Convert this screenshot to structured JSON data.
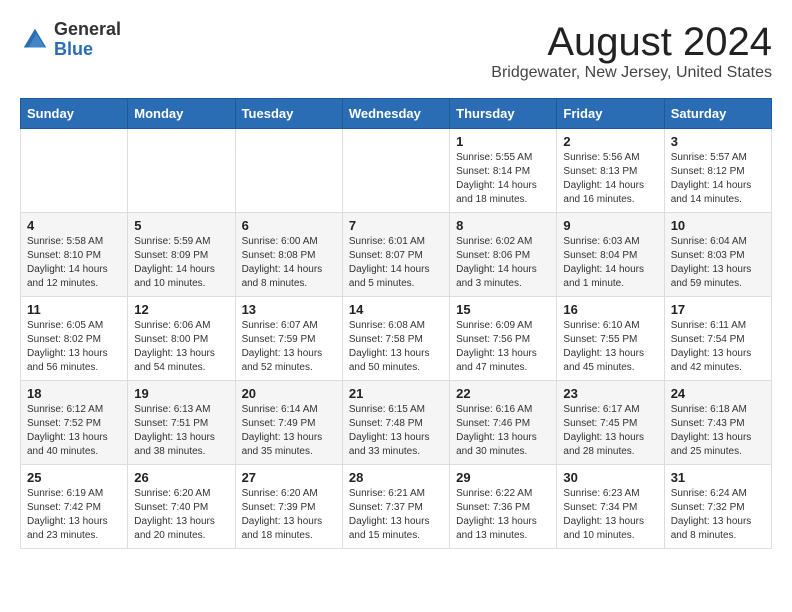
{
  "header": {
    "logo_general": "General",
    "logo_blue": "Blue",
    "main_title": "August 2024",
    "subtitle": "Bridgewater, New Jersey, United States"
  },
  "days_of_week": [
    "Sunday",
    "Monday",
    "Tuesday",
    "Wednesday",
    "Thursday",
    "Friday",
    "Saturday"
  ],
  "weeks": [
    [
      {
        "day": "",
        "info": ""
      },
      {
        "day": "",
        "info": ""
      },
      {
        "day": "",
        "info": ""
      },
      {
        "day": "",
        "info": ""
      },
      {
        "day": "1",
        "info": "Sunrise: 5:55 AM\nSunset: 8:14 PM\nDaylight: 14 hours\nand 18 minutes."
      },
      {
        "day": "2",
        "info": "Sunrise: 5:56 AM\nSunset: 8:13 PM\nDaylight: 14 hours\nand 16 minutes."
      },
      {
        "day": "3",
        "info": "Sunrise: 5:57 AM\nSunset: 8:12 PM\nDaylight: 14 hours\nand 14 minutes."
      }
    ],
    [
      {
        "day": "4",
        "info": "Sunrise: 5:58 AM\nSunset: 8:10 PM\nDaylight: 14 hours\nand 12 minutes."
      },
      {
        "day": "5",
        "info": "Sunrise: 5:59 AM\nSunset: 8:09 PM\nDaylight: 14 hours\nand 10 minutes."
      },
      {
        "day": "6",
        "info": "Sunrise: 6:00 AM\nSunset: 8:08 PM\nDaylight: 14 hours\nand 8 minutes."
      },
      {
        "day": "7",
        "info": "Sunrise: 6:01 AM\nSunset: 8:07 PM\nDaylight: 14 hours\nand 5 minutes."
      },
      {
        "day": "8",
        "info": "Sunrise: 6:02 AM\nSunset: 8:06 PM\nDaylight: 14 hours\nand 3 minutes."
      },
      {
        "day": "9",
        "info": "Sunrise: 6:03 AM\nSunset: 8:04 PM\nDaylight: 14 hours\nand 1 minute."
      },
      {
        "day": "10",
        "info": "Sunrise: 6:04 AM\nSunset: 8:03 PM\nDaylight: 13 hours\nand 59 minutes."
      }
    ],
    [
      {
        "day": "11",
        "info": "Sunrise: 6:05 AM\nSunset: 8:02 PM\nDaylight: 13 hours\nand 56 minutes."
      },
      {
        "day": "12",
        "info": "Sunrise: 6:06 AM\nSunset: 8:00 PM\nDaylight: 13 hours\nand 54 minutes."
      },
      {
        "day": "13",
        "info": "Sunrise: 6:07 AM\nSunset: 7:59 PM\nDaylight: 13 hours\nand 52 minutes."
      },
      {
        "day": "14",
        "info": "Sunrise: 6:08 AM\nSunset: 7:58 PM\nDaylight: 13 hours\nand 50 minutes."
      },
      {
        "day": "15",
        "info": "Sunrise: 6:09 AM\nSunset: 7:56 PM\nDaylight: 13 hours\nand 47 minutes."
      },
      {
        "day": "16",
        "info": "Sunrise: 6:10 AM\nSunset: 7:55 PM\nDaylight: 13 hours\nand 45 minutes."
      },
      {
        "day": "17",
        "info": "Sunrise: 6:11 AM\nSunset: 7:54 PM\nDaylight: 13 hours\nand 42 minutes."
      }
    ],
    [
      {
        "day": "18",
        "info": "Sunrise: 6:12 AM\nSunset: 7:52 PM\nDaylight: 13 hours\nand 40 minutes."
      },
      {
        "day": "19",
        "info": "Sunrise: 6:13 AM\nSunset: 7:51 PM\nDaylight: 13 hours\nand 38 minutes."
      },
      {
        "day": "20",
        "info": "Sunrise: 6:14 AM\nSunset: 7:49 PM\nDaylight: 13 hours\nand 35 minutes."
      },
      {
        "day": "21",
        "info": "Sunrise: 6:15 AM\nSunset: 7:48 PM\nDaylight: 13 hours\nand 33 minutes."
      },
      {
        "day": "22",
        "info": "Sunrise: 6:16 AM\nSunset: 7:46 PM\nDaylight: 13 hours\nand 30 minutes."
      },
      {
        "day": "23",
        "info": "Sunrise: 6:17 AM\nSunset: 7:45 PM\nDaylight: 13 hours\nand 28 minutes."
      },
      {
        "day": "24",
        "info": "Sunrise: 6:18 AM\nSunset: 7:43 PM\nDaylight: 13 hours\nand 25 minutes."
      }
    ],
    [
      {
        "day": "25",
        "info": "Sunrise: 6:19 AM\nSunset: 7:42 PM\nDaylight: 13 hours\nand 23 minutes."
      },
      {
        "day": "26",
        "info": "Sunrise: 6:20 AM\nSunset: 7:40 PM\nDaylight: 13 hours\nand 20 minutes."
      },
      {
        "day": "27",
        "info": "Sunrise: 6:20 AM\nSunset: 7:39 PM\nDaylight: 13 hours\nand 18 minutes."
      },
      {
        "day": "28",
        "info": "Sunrise: 6:21 AM\nSunset: 7:37 PM\nDaylight: 13 hours\nand 15 minutes."
      },
      {
        "day": "29",
        "info": "Sunrise: 6:22 AM\nSunset: 7:36 PM\nDaylight: 13 hours\nand 13 minutes."
      },
      {
        "day": "30",
        "info": "Sunrise: 6:23 AM\nSunset: 7:34 PM\nDaylight: 13 hours\nand 10 minutes."
      },
      {
        "day": "31",
        "info": "Sunrise: 6:24 AM\nSunset: 7:32 PM\nDaylight: 13 hours\nand 8 minutes."
      }
    ]
  ]
}
